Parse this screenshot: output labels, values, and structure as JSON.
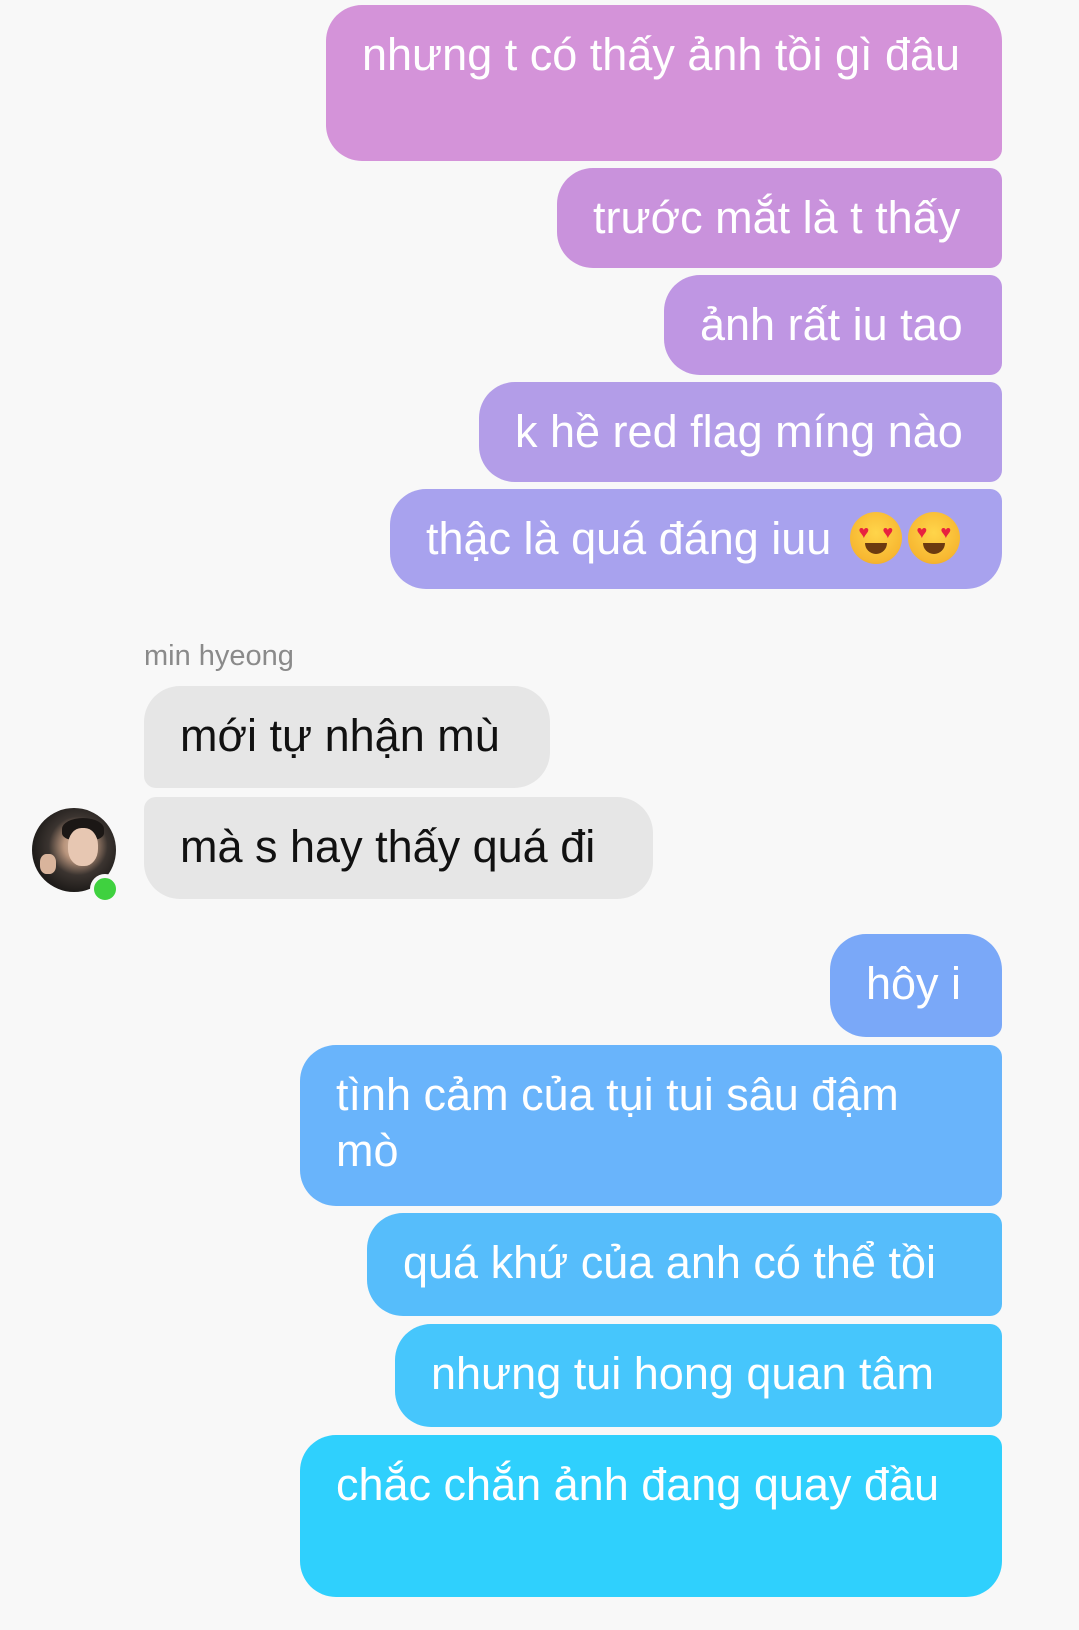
{
  "conversation": {
    "outgoing_group_1": [
      {
        "text": "nhưng t có thấy ảnh tồi gì đâu",
        "color": "#d493d9"
      },
      {
        "text": "trước mắt là t thấy",
        "color": "#c992dc"
      },
      {
        "text": "ảnh rất iu tao",
        "color": "#bf96e3"
      },
      {
        "text": "k hề red flag míng nào",
        "color": "#b39de8"
      },
      {
        "text": "thậc là quá đáng iuu",
        "color": "#a8a2ee",
        "emoji": [
          "heart-eyes-emoji",
          "heart-eyes-emoji"
        ]
      }
    ],
    "incoming": {
      "sender_name": "min hyeong",
      "messages": [
        {
          "text": "mới tự nhận mù"
        },
        {
          "text": "mà s hay thấy quá đi"
        }
      ],
      "online_status": "online",
      "bubble_color": "#e6e6e6"
    },
    "outgoing_group_2": [
      {
        "text": "hôy i",
        "color": "#7aa8f8"
      },
      {
        "text": "tình cảm của tụi tui sâu đậm mò",
        "color": "#69b4fb"
      },
      {
        "text": "quá khứ của anh có thể tồi",
        "color": "#56bdfb"
      },
      {
        "text": "nhưng tui hong quan tâm",
        "color": "#46c6fc"
      },
      {
        "text": "chắc chắn ảnh đang quay đầu",
        "color": "#2fd0fd"
      }
    ]
  }
}
